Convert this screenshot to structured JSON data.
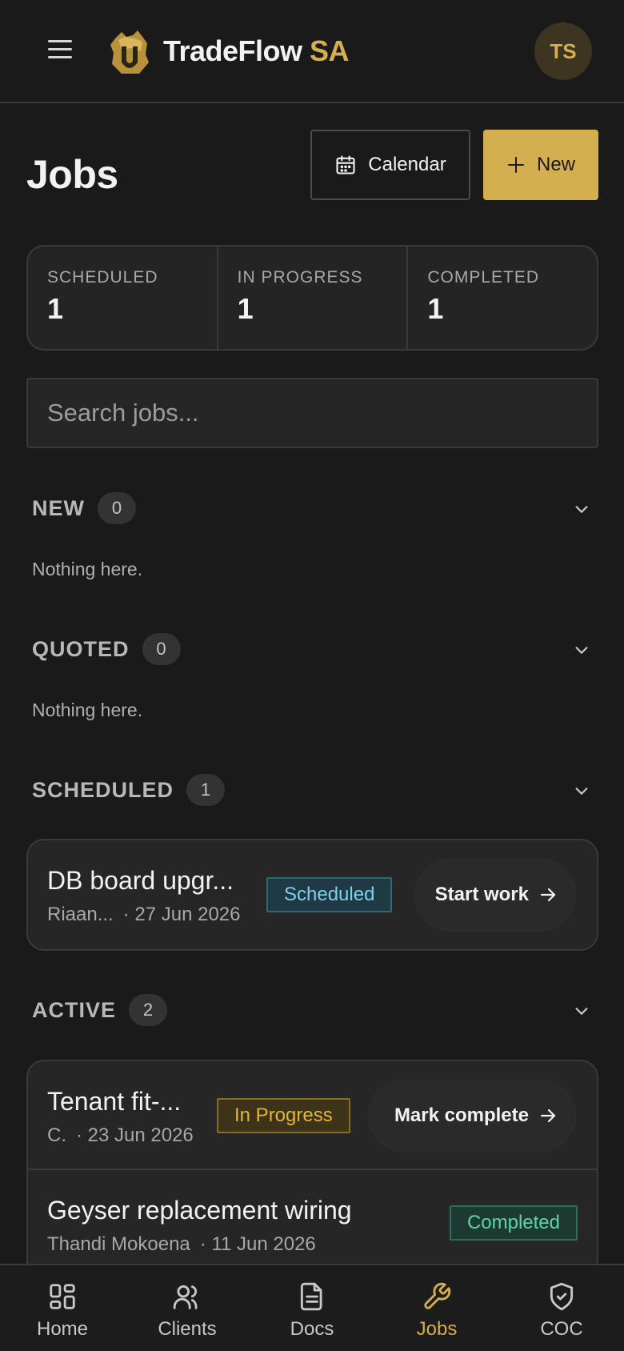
{
  "header": {
    "brand_main": "TradeFlow",
    "brand_accent": "SA",
    "avatar_initials": "TS"
  },
  "page": {
    "title": "Jobs",
    "calendar_label": "Calendar",
    "new_label": "New"
  },
  "stats": [
    {
      "label": "SCHEDULED",
      "value": "1"
    },
    {
      "label": "IN PROGRESS",
      "value": "1"
    },
    {
      "label": "COMPLETED",
      "value": "1"
    }
  ],
  "search": {
    "placeholder": "Search jobs..."
  },
  "sections": {
    "new": {
      "title": "NEW",
      "count": "0",
      "empty": "Nothing here."
    },
    "quoted": {
      "title": "QUOTED",
      "count": "0",
      "empty": "Nothing here."
    },
    "scheduled": {
      "title": "SCHEDULED",
      "count": "1"
    },
    "active": {
      "title": "ACTIVE",
      "count": "2"
    }
  },
  "jobs": {
    "scheduled": [
      {
        "title": "DB board upgr...",
        "client": "Riaan...",
        "date": "· 27 Jun 2026",
        "status": "Scheduled",
        "action": "Start work"
      }
    ],
    "active": [
      {
        "title": "Tenant fit-...",
        "client": "C.",
        "date": "· 23 Jun 2026",
        "status": "In Progress",
        "action": "Mark complete"
      },
      {
        "title": "Geyser replacement wiring",
        "client": "Thandi Mokoena",
        "date": "· 11 Jun 2026",
        "status": "Completed"
      }
    ]
  },
  "nav": [
    {
      "label": "Home",
      "icon": "grid-icon"
    },
    {
      "label": "Clients",
      "icon": "users-icon"
    },
    {
      "label": "Docs",
      "icon": "document-icon"
    },
    {
      "label": "Jobs",
      "icon": "wrench-icon",
      "active": true
    },
    {
      "label": "COC",
      "icon": "shield-check-icon"
    }
  ],
  "colors": {
    "background": "#1a1a1a",
    "accent": "#d4af4f",
    "scheduled": "#7fd0e8",
    "in_progress": "#e2b63d",
    "completed": "#5fd3a8"
  }
}
